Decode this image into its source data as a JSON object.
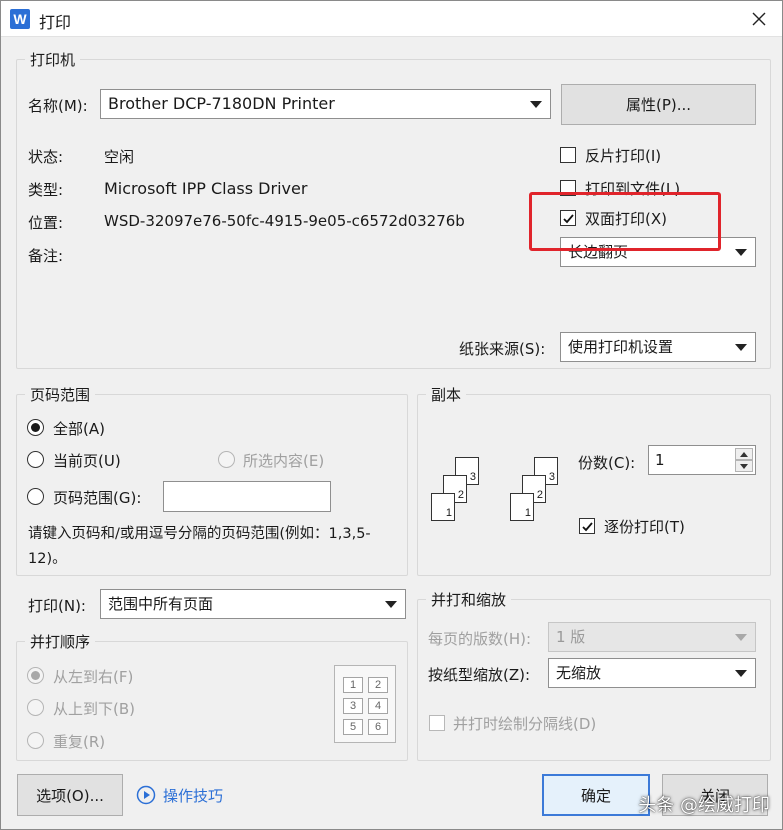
{
  "window": {
    "title": "打印",
    "app_icon_letter": "W"
  },
  "printer": {
    "group_label": "打印机",
    "name_label": "名称(M):",
    "name_value": "Brother DCP-7180DN Printer",
    "properties_button": "属性(P)...",
    "status_label": "状态:",
    "status_value": "空闲",
    "type_label": "类型:",
    "type_value": "Microsoft IPP Class Driver",
    "location_label": "位置:",
    "location_value": "WSD-32097e76-50fc-4915-9e05-c6572d03276b",
    "comment_label": "备注:",
    "reverse_print": {
      "label": "反片打印(I)",
      "checked": false
    },
    "print_to_file": {
      "label": "打印到文件(L)",
      "checked": false
    },
    "duplex_print": {
      "label": "双面打印(X)",
      "checked": true
    },
    "flip_option": "长边翻页",
    "paper_source_label": "纸张来源(S):",
    "paper_source_value": "使用打印机设置"
  },
  "page_range": {
    "group_label": "页码范围",
    "all": "全部(A)",
    "current": "当前页(U)",
    "selection": "所选内容(E)",
    "pages": "页码范围(G):",
    "pages_value": "",
    "hint": "请键入页码和/或用逗号分隔的页码范围(例如：1,3,5-12)。",
    "selected": "all"
  },
  "copies": {
    "group_label": "副本",
    "count_label": "份数(C):",
    "count_value": "1",
    "collate": {
      "label": "逐份打印(T)",
      "checked": true
    },
    "page_numbers": [
      "1",
      "2",
      "3"
    ]
  },
  "print_what": {
    "label": "打印(N):",
    "value": "范围中所有页面"
  },
  "print_order": {
    "group_label": "并打顺序",
    "left_to_right": "从左到右(F)",
    "top_to_bottom": "从上到下(B)",
    "repeat": "重复(R)",
    "grid_numbers": [
      "1",
      "2",
      "3",
      "4",
      "5",
      "6"
    ]
  },
  "zoom": {
    "group_label": "并打和缩放",
    "pages_per_sheet_label": "每页的版数(H):",
    "pages_per_sheet_value": "1 版",
    "scale_label": "按纸型缩放(Z):",
    "scale_value": "无缩放",
    "draw_borders": {
      "label": "并打时绘制分隔线(D)",
      "checked": false
    }
  },
  "footer": {
    "options_button": "选项(O)...",
    "tips_link": "操作技巧",
    "ok_button": "确定",
    "close_button": "关闭"
  },
  "watermark": "头条 @绘威打印",
  "colors": {
    "highlight": "#e0242b",
    "accent": "#3c7ad8"
  }
}
